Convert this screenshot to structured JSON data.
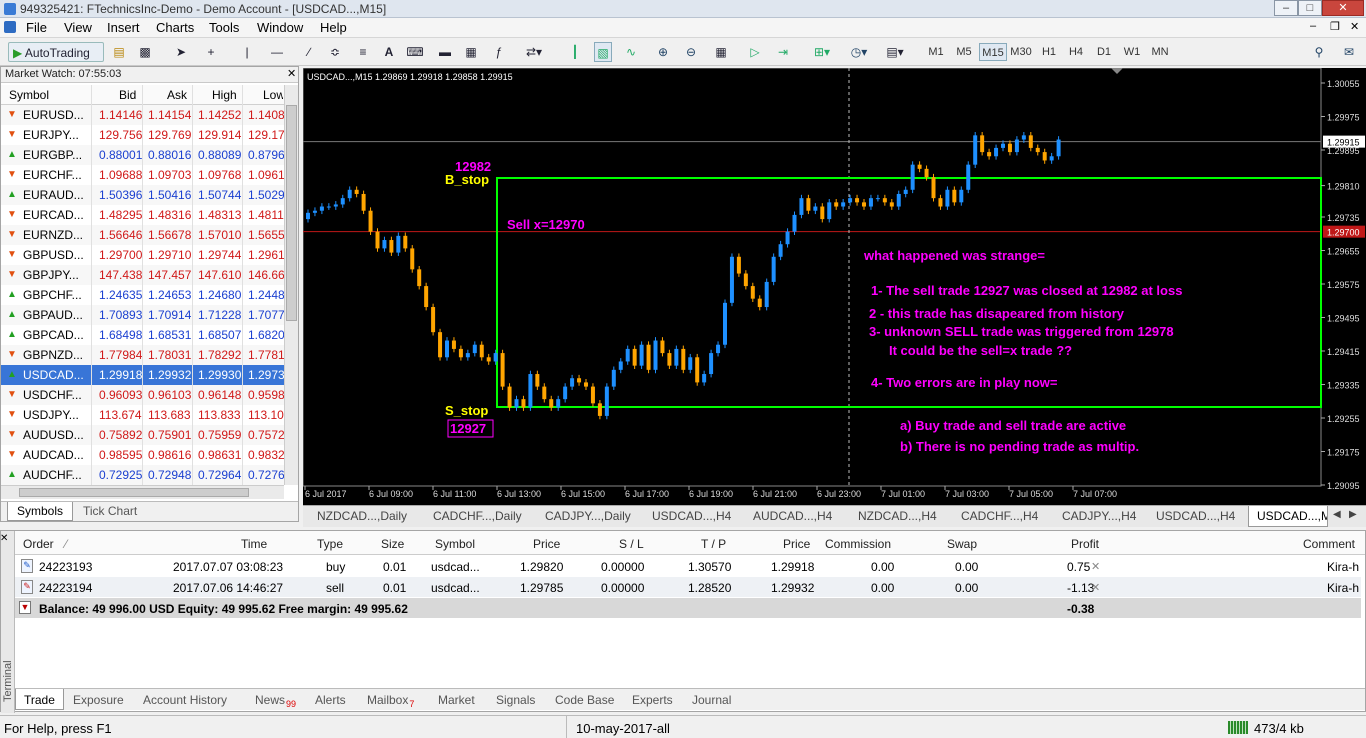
{
  "window": {
    "title": "949325421: FTechnicsInc-Demo - Demo Account - [USDCAD...,M15]"
  },
  "menu": [
    "File",
    "View",
    "Insert",
    "Charts",
    "Tools",
    "Window",
    "Help"
  ],
  "toolbar": {
    "autotrading_label": "AutoTrading",
    "timeframes": [
      "M1",
      "M5",
      "M15",
      "M30",
      "H1",
      "H4",
      "D1",
      "W1",
      "MN"
    ],
    "active_timeframe": "M15"
  },
  "market_watch": {
    "title": "Market Watch: 07:55:03",
    "columns": [
      "Symbol",
      "Bid",
      "Ask",
      "High",
      "Low"
    ],
    "rows": [
      {
        "symbol": "EURUSD...",
        "bid": "1.14146",
        "ask": "1.14154",
        "high": "1.14252",
        "low": "1.1408",
        "dir": "down"
      },
      {
        "symbol": "EURJPY...",
        "bid": "129.756",
        "ask": "129.769",
        "high": "129.914",
        "low": "129.17",
        "dir": "down"
      },
      {
        "symbol": "EURGBP...",
        "bid": "0.88001",
        "ask": "0.88016",
        "high": "0.88089",
        "low": "0.8796",
        "dir": "up"
      },
      {
        "symbol": "EURCHF...",
        "bid": "1.09688",
        "ask": "1.09703",
        "high": "1.09768",
        "low": "1.0961",
        "dir": "down"
      },
      {
        "symbol": "EURAUD...",
        "bid": "1.50396",
        "ask": "1.50416",
        "high": "1.50744",
        "low": "1.5029",
        "dir": "up"
      },
      {
        "symbol": "EURCAD...",
        "bid": "1.48295",
        "ask": "1.48316",
        "high": "1.48313",
        "low": "1.4811",
        "dir": "down"
      },
      {
        "symbol": "EURNZD...",
        "bid": "1.56646",
        "ask": "1.56678",
        "high": "1.57010",
        "low": "1.5655",
        "dir": "down"
      },
      {
        "symbol": "GBPUSD...",
        "bid": "1.29700",
        "ask": "1.29710",
        "high": "1.29744",
        "low": "1.2961",
        "dir": "down"
      },
      {
        "symbol": "GBPJPY...",
        "bid": "147.438",
        "ask": "147.457",
        "high": "147.610",
        "low": "146.66",
        "dir": "down"
      },
      {
        "symbol": "GBPCHF...",
        "bid": "1.24635",
        "ask": "1.24653",
        "high": "1.24680",
        "low": "1.2448",
        "dir": "up"
      },
      {
        "symbol": "GBPAUD...",
        "bid": "1.70893",
        "ask": "1.70914",
        "high": "1.71228",
        "low": "1.7077",
        "dir": "up"
      },
      {
        "symbol": "GBPCAD...",
        "bid": "1.68498",
        "ask": "1.68531",
        "high": "1.68507",
        "low": "1.6820",
        "dir": "up"
      },
      {
        "symbol": "GBPNZD...",
        "bid": "1.77984",
        "ask": "1.78031",
        "high": "1.78292",
        "low": "1.7781",
        "dir": "down"
      },
      {
        "symbol": "USDCAD...",
        "bid": "1.29918",
        "ask": "1.29932",
        "high": "1.29930",
        "low": "1.2973",
        "dir": "up"
      },
      {
        "symbol": "USDCHF...",
        "bid": "0.96093",
        "ask": "0.96103",
        "high": "0.96148",
        "low": "0.9598",
        "dir": "down"
      },
      {
        "symbol": "USDJPY...",
        "bid": "113.674",
        "ask": "113.683",
        "high": "113.833",
        "low": "113.10",
        "dir": "down"
      },
      {
        "symbol": "AUDUSD...",
        "bid": "0.75892",
        "ask": "0.75901",
        "high": "0.75959",
        "low": "0.7572",
        "dir": "down"
      },
      {
        "symbol": "AUDCAD...",
        "bid": "0.98595",
        "ask": "0.98616",
        "high": "0.98631",
        "low": "0.9832",
        "dir": "down"
      },
      {
        "symbol": "AUDCHF...",
        "bid": "0.72925",
        "ask": "0.72948",
        "high": "0.72964",
        "low": "0.7276",
        "dir": "up"
      }
    ],
    "tabs": [
      "Symbols",
      "Tick Chart"
    ]
  },
  "chart": {
    "header": "USDCAD...,M15  1.29869 1.29918 1.29858 1.29915",
    "price_labels": [
      "1.30055",
      "1.29975",
      "1.29915",
      "1.29895",
      "1.29810",
      "1.29735",
      "1.29700",
      "1.29655",
      "1.29575",
      "1.29495",
      "1.29415",
      "1.29335",
      "1.29255",
      "1.29175",
      "1.29095"
    ],
    "current_price": "1.29915",
    "line_price": "1.29700",
    "time_labels": [
      "6 Jul 2017",
      "6 Jul 09:00",
      "6 Jul 11:00",
      "6 Jul 13:00",
      "6 Jul 15:00",
      "6 Jul 17:00",
      "6 Jul 19:00",
      "6 Jul 21:00",
      "6 Jul 23:00",
      "7 Jul 01:00",
      "7 Jul 03:00",
      "7 Jul 05:00",
      "7 Jul 07:00"
    ],
    "annotations": {
      "b_stop_value": "12982",
      "b_stop_label": "B_stop",
      "sell_label": "Sell x=12970",
      "s_stop_label": "S_stop",
      "s_stop_value": "12927",
      "note_title": "what happened was strange=",
      "note_1": "1- The sell trade 12927 was closed at 12982 at loss",
      "note_2": "2 - this trade has disapeared from history",
      "note_3": "3- unknown  SELL trade was triggered from 12978",
      "note_3b": "It could be the sell=x trade ??",
      "note_4": "4- Two errors are in play now=",
      "note_a": "a) Buy trade and sell trade are active",
      "note_b": "b) There is no pending trade as multip."
    },
    "colors": {
      "bull": "#1e90ff",
      "bear": "#ffa500",
      "box": "#00ff00",
      "sell_line": "#c01818",
      "magenta": "#ff00ff",
      "yellow": "#ffff00"
    }
  },
  "chart_tabs": [
    "NZDCAD...,Daily",
    "CADCHF...,Daily",
    "CADJPY...,Daily",
    "USDCAD...,H4",
    "AUDCAD...,H4",
    "NZDCAD...,H4",
    "CADCHF...,H4",
    "CADJPY...,H4",
    "USDCAD...,H4",
    "USDCAD...,M"
  ],
  "terminal": {
    "columns": [
      "Order",
      "Time",
      "Type",
      "Size",
      "Symbol",
      "Price",
      "S / L",
      "T / P",
      "Price",
      "Commission",
      "Swap",
      "Profit",
      "Comment"
    ],
    "rows": [
      {
        "order": "24223193",
        "time": "2017.07.07 03:08:23",
        "type": "buy",
        "size": "0.01",
        "symbol": "usdcad...",
        "price": "1.29820",
        "sl": "0.00000",
        "tp": "1.30570",
        "cur": "1.29918",
        "commission": "0.00",
        "swap": "0.00",
        "profit": "0.75",
        "comment": "Kira-h"
      },
      {
        "order": "24223194",
        "time": "2017.07.06 14:46:27",
        "type": "sell",
        "size": "0.01",
        "symbol": "usdcad...",
        "price": "1.29785",
        "sl": "0.00000",
        "tp": "1.28520",
        "cur": "1.29932",
        "commission": "0.00",
        "swap": "0.00",
        "profit": "-1.13",
        "comment": "Kira-h"
      }
    ],
    "balance_line": "Balance: 49 996.00 USD  Equity: 49 995.62  Free margin: 49 995.62",
    "total_profit": "-0.38",
    "side_label": "Terminal",
    "tabs": [
      {
        "label": "Trade",
        "badge": ""
      },
      {
        "label": "Exposure",
        "badge": ""
      },
      {
        "label": "Account History",
        "badge": ""
      },
      {
        "label": "News",
        "badge": "99"
      },
      {
        "label": "Alerts",
        "badge": ""
      },
      {
        "label": "Mailbox",
        "badge": "7"
      },
      {
        "label": "Market",
        "badge": ""
      },
      {
        "label": "Signals",
        "badge": ""
      },
      {
        "label": "Code Base",
        "badge": ""
      },
      {
        "label": "Experts",
        "badge": ""
      },
      {
        "label": "Journal",
        "badge": ""
      }
    ]
  },
  "status": {
    "help": "For Help, press F1",
    "profile": "10-may-2017-all",
    "traffic": "473/4 kb"
  }
}
